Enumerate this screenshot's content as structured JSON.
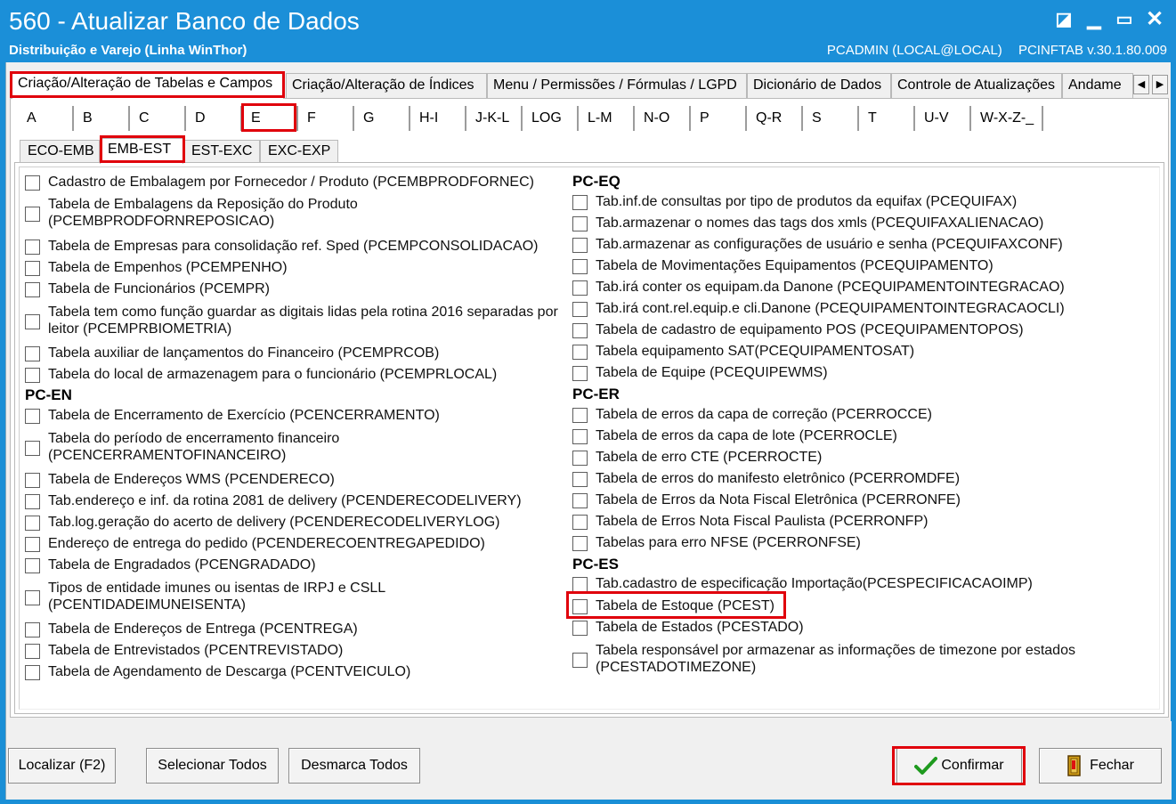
{
  "window": {
    "title": "560 - Atualizar Banco de Dados",
    "subtitle": "Distribuição e Varejo (Linha WinThor)",
    "user": "PCADMIN (LOCAL@LOCAL)",
    "version": "PCINFTAB  v.30.1.80.009",
    "controls": {
      "restore": "◪",
      "minimize": "▁",
      "maximize": "▭",
      "close": "✕"
    }
  },
  "top_tabs": [
    "Criação/Alteração de Tabelas e Campos",
    "Criação/Alteração de Índices",
    "Menu / Permissões / Fórmulas / LGPD",
    "Dicionário de Dados",
    "Controle de Atualizações",
    "Andame"
  ],
  "tab_scroll": {
    "left": "◀",
    "right": "▶"
  },
  "letter_tabs": [
    "A",
    "B",
    "C",
    "D",
    "E",
    "F",
    "G",
    "H-I",
    "J-K-L",
    "LOG",
    "L-M",
    "N-O",
    "P",
    "Q-R",
    "S",
    "T",
    "U-V",
    "W-X-Z-_"
  ],
  "sub_tabs": [
    "ECO-EMB",
    "EMB-EST",
    "EST-EXC",
    "EXC-EXP"
  ],
  "left_column": {
    "items_a": [
      "Cadastro de Embalagem por Fornecedor / Produto (PCEMBPRODFORNEC)",
      "Tabela de Embalagens da Reposição do Produto\n(PCEMBPRODFORNREPOSICAO)",
      "Tabela de Empresas para consolidação ref. Sped (PCEMPCONSOLIDACAO)",
      "Tabela de Empenhos (PCEMPENHO)",
      "Tabela de Funcionários (PCEMPR)",
      "Tabela tem como função guardar as digitais lidas pela rotina 2016 separadas por\nleitor (PCEMPRBIOMETRIA)",
      "Tabela auxiliar de lançamentos do Financeiro (PCEMPRCOB)",
      "Tabela do local de armazenagem para o funcionário (PCEMPRLOCAL)"
    ],
    "section_en": "PC-EN",
    "items_en": [
      "Tabela de Encerramento de Exercício (PCENCERRAMENTO)",
      "Tabela do período de encerramento financeiro\n(PCENCERRAMENTOFINANCEIRO)",
      "Tabela de Endereços WMS (PCENDERECO)",
      "Tab.endereço e inf. da rotina 2081 de delivery (PCENDERECODELIVERY)",
      "Tab.log.geração do acerto de delivery (PCENDERECODELIVERYLOG)",
      "Endereço de entrega do pedido (PCENDERECOENTREGAPEDIDO)",
      "Tabela de Engradados (PCENGRADADO)",
      "Tipos de entidade imunes ou isentas de IRPJ e CSLL\n(PCENTIDADEIMUNEISENTA)",
      "Tabela de Endereços de Entrega (PCENTREGA)",
      "Tabela de Entrevistados (PCENTREVISTADO)",
      "Tabela de Agendamento de Descarga (PCENTVEICULO)"
    ]
  },
  "right_column": {
    "section_eq": "PC-EQ",
    "items_eq": [
      "Tab.inf.de consultas por tipo de produtos da equifax (PCEQUIFAX)",
      "Tab.armazenar o nomes das tags dos xmls (PCEQUIFAXALIENACAO)",
      "Tab.armazenar as configurações de usuário e senha (PCEQUIFAXCONF)",
      "Tabela de Movimentações Equipamentos (PCEQUIPAMENTO)",
      "Tab.irá conter os equipam.da Danone (PCEQUIPAMENTOINTEGRACAO)",
      "Tab.irá cont.rel.equip.e cli.Danone (PCEQUIPAMENTOINTEGRACAOCLI)",
      "Tabela de cadastro de equipamento POS (PCEQUIPAMENTOPOS)",
      "Tabela equipamento SAT(PCEQUIPAMENTOSAT)",
      "Tabela de Equipe (PCEQUIPEWMS)"
    ],
    "section_er": "PC-ER",
    "items_er": [
      "Tabela de erros da capa de correção (PCERROCCE)",
      "Tabela de erros da capa de lote (PCERROCLE)",
      "Tabela de erro CTE (PCERROCTE)",
      "Tabela de erros do manifesto eletrônico (PCERROMDFE)",
      "Tabela de Erros da Nota Fiscal Eletrônica (PCERRONFE)",
      "Tabela de Erros Nota Fiscal Paulista (PCERRONFP)",
      "Tabelas para erro NFSE (PCERRONFSE)"
    ],
    "section_es": "PC-ES",
    "items_es": [
      "Tab.cadastro de especificação Importação(PCESPECIFICACAOIMP)",
      "Tabela de Estoque (PCEST)",
      "Tabela de Estados (PCESTADO)",
      "Tabela responsável por armazenar as informações de timezone por estados\n(PCESTADOTIMEZONE)"
    ]
  },
  "buttons": {
    "localizar": "Localizar (F2)",
    "selecionar": "Selecionar Todos",
    "desmarca": "Desmarca Todos",
    "confirmar": "Confirmar",
    "fechar": "Fechar"
  },
  "colors": {
    "titlebar": "#1b8fd8",
    "highlight": "#e0000b",
    "check": "#1e9a1e"
  }
}
